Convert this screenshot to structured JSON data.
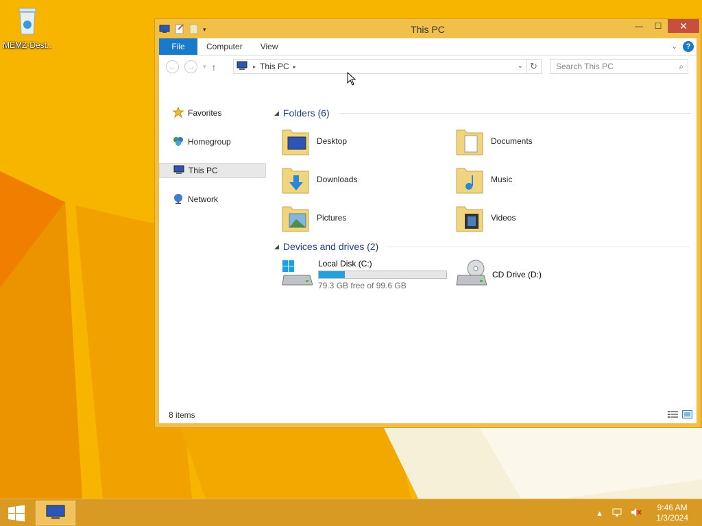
{
  "desktop": {
    "icons": [
      {
        "label": "MEMZ-Dest...",
        "icon": "recycle-bin-icon"
      }
    ]
  },
  "window": {
    "title": "This PC",
    "quick_access": [
      "properties-icon",
      "new-folder-icon",
      "customize-qat-icon"
    ],
    "controls": {
      "minimize": "—",
      "maximize": "☐",
      "close": "✕"
    },
    "ribbon": {
      "tabs": [
        "File",
        "Computer",
        "View"
      ],
      "help_label": "?"
    },
    "address": {
      "path": [
        "This PC"
      ],
      "search_placeholder": "Search This PC"
    },
    "nav_pane": [
      {
        "label": "Favorites",
        "icon": "star-icon"
      },
      {
        "label": "Homegroup",
        "icon": "homegroup-icon"
      },
      {
        "label": "This PC",
        "icon": "computer-icon",
        "selected": true
      },
      {
        "label": "Network",
        "icon": "network-icon"
      }
    ],
    "folders": {
      "header": "Folders (6)",
      "items": [
        {
          "name": "Desktop"
        },
        {
          "name": "Documents"
        },
        {
          "name": "Downloads"
        },
        {
          "name": "Music"
        },
        {
          "name": "Pictures"
        },
        {
          "name": "Videos"
        }
      ]
    },
    "drives": {
      "header": "Devices and drives (2)",
      "items": [
        {
          "name": "Local Disk (C:)",
          "free_text": "79.3 GB free of 99.6 GB",
          "used_fraction": 0.204
        },
        {
          "name": "CD Drive (D:)"
        }
      ]
    },
    "status": {
      "items_count": "8 items"
    }
  },
  "taskbar": {
    "clock_time": "9:46 AM",
    "clock_date": "1/3/2024"
  },
  "colors": {
    "accent": "#1979ca",
    "desktop": "#f5b400",
    "window_frame": "#f0c04a",
    "progress": "#26a0da"
  }
}
